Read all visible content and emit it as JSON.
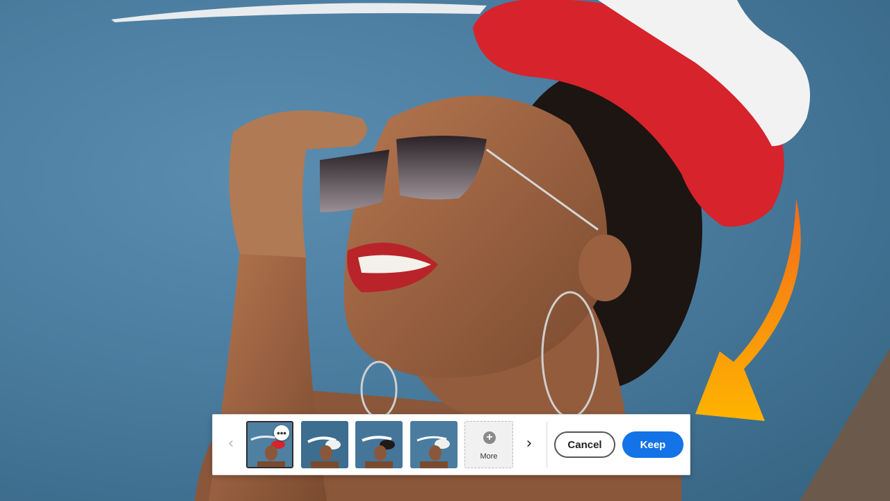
{
  "canvas": {
    "image": "portrait-woman-red-hat-sunglasses"
  },
  "toolbar": {
    "prev_label": "‹",
    "next_label": "›",
    "thumbnails": [
      {
        "name": "variation-1",
        "selected": true
      },
      {
        "name": "variation-2",
        "selected": false
      },
      {
        "name": "variation-3",
        "selected": false
      },
      {
        "name": "variation-4",
        "selected": false
      }
    ],
    "options_label": "•••",
    "more_icon": "+",
    "more_label": "More",
    "cancel_label": "Cancel",
    "keep_label": "Keep"
  },
  "colors": {
    "accent": "#1473e6",
    "arrow_start": "#ffb400",
    "arrow_end": "#f26a1b",
    "hat_red": "#d7232c"
  }
}
